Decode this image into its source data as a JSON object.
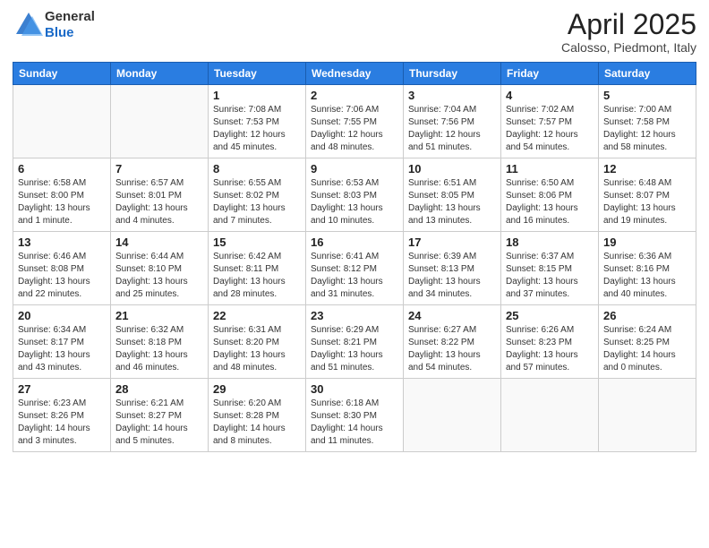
{
  "header": {
    "logo_general": "General",
    "logo_blue": "Blue",
    "title": "April 2025",
    "subtitle": "Calosso, Piedmont, Italy"
  },
  "calendar": {
    "days_of_week": [
      "Sunday",
      "Monday",
      "Tuesday",
      "Wednesday",
      "Thursday",
      "Friday",
      "Saturday"
    ],
    "weeks": [
      [
        {
          "day": "",
          "info": ""
        },
        {
          "day": "",
          "info": ""
        },
        {
          "day": "1",
          "info": "Sunrise: 7:08 AM\nSunset: 7:53 PM\nDaylight: 12 hours and 45 minutes."
        },
        {
          "day": "2",
          "info": "Sunrise: 7:06 AM\nSunset: 7:55 PM\nDaylight: 12 hours and 48 minutes."
        },
        {
          "day": "3",
          "info": "Sunrise: 7:04 AM\nSunset: 7:56 PM\nDaylight: 12 hours and 51 minutes."
        },
        {
          "day": "4",
          "info": "Sunrise: 7:02 AM\nSunset: 7:57 PM\nDaylight: 12 hours and 54 minutes."
        },
        {
          "day": "5",
          "info": "Sunrise: 7:00 AM\nSunset: 7:58 PM\nDaylight: 12 hours and 58 minutes."
        }
      ],
      [
        {
          "day": "6",
          "info": "Sunrise: 6:58 AM\nSunset: 8:00 PM\nDaylight: 13 hours and 1 minute."
        },
        {
          "day": "7",
          "info": "Sunrise: 6:57 AM\nSunset: 8:01 PM\nDaylight: 13 hours and 4 minutes."
        },
        {
          "day": "8",
          "info": "Sunrise: 6:55 AM\nSunset: 8:02 PM\nDaylight: 13 hours and 7 minutes."
        },
        {
          "day": "9",
          "info": "Sunrise: 6:53 AM\nSunset: 8:03 PM\nDaylight: 13 hours and 10 minutes."
        },
        {
          "day": "10",
          "info": "Sunrise: 6:51 AM\nSunset: 8:05 PM\nDaylight: 13 hours and 13 minutes."
        },
        {
          "day": "11",
          "info": "Sunrise: 6:50 AM\nSunset: 8:06 PM\nDaylight: 13 hours and 16 minutes."
        },
        {
          "day": "12",
          "info": "Sunrise: 6:48 AM\nSunset: 8:07 PM\nDaylight: 13 hours and 19 minutes."
        }
      ],
      [
        {
          "day": "13",
          "info": "Sunrise: 6:46 AM\nSunset: 8:08 PM\nDaylight: 13 hours and 22 minutes."
        },
        {
          "day": "14",
          "info": "Sunrise: 6:44 AM\nSunset: 8:10 PM\nDaylight: 13 hours and 25 minutes."
        },
        {
          "day": "15",
          "info": "Sunrise: 6:42 AM\nSunset: 8:11 PM\nDaylight: 13 hours and 28 minutes."
        },
        {
          "day": "16",
          "info": "Sunrise: 6:41 AM\nSunset: 8:12 PM\nDaylight: 13 hours and 31 minutes."
        },
        {
          "day": "17",
          "info": "Sunrise: 6:39 AM\nSunset: 8:13 PM\nDaylight: 13 hours and 34 minutes."
        },
        {
          "day": "18",
          "info": "Sunrise: 6:37 AM\nSunset: 8:15 PM\nDaylight: 13 hours and 37 minutes."
        },
        {
          "day": "19",
          "info": "Sunrise: 6:36 AM\nSunset: 8:16 PM\nDaylight: 13 hours and 40 minutes."
        }
      ],
      [
        {
          "day": "20",
          "info": "Sunrise: 6:34 AM\nSunset: 8:17 PM\nDaylight: 13 hours and 43 minutes."
        },
        {
          "day": "21",
          "info": "Sunrise: 6:32 AM\nSunset: 8:18 PM\nDaylight: 13 hours and 46 minutes."
        },
        {
          "day": "22",
          "info": "Sunrise: 6:31 AM\nSunset: 8:20 PM\nDaylight: 13 hours and 48 minutes."
        },
        {
          "day": "23",
          "info": "Sunrise: 6:29 AM\nSunset: 8:21 PM\nDaylight: 13 hours and 51 minutes."
        },
        {
          "day": "24",
          "info": "Sunrise: 6:27 AM\nSunset: 8:22 PM\nDaylight: 13 hours and 54 minutes."
        },
        {
          "day": "25",
          "info": "Sunrise: 6:26 AM\nSunset: 8:23 PM\nDaylight: 13 hours and 57 minutes."
        },
        {
          "day": "26",
          "info": "Sunrise: 6:24 AM\nSunset: 8:25 PM\nDaylight: 14 hours and 0 minutes."
        }
      ],
      [
        {
          "day": "27",
          "info": "Sunrise: 6:23 AM\nSunset: 8:26 PM\nDaylight: 14 hours and 3 minutes."
        },
        {
          "day": "28",
          "info": "Sunrise: 6:21 AM\nSunset: 8:27 PM\nDaylight: 14 hours and 5 minutes."
        },
        {
          "day": "29",
          "info": "Sunrise: 6:20 AM\nSunset: 8:28 PM\nDaylight: 14 hours and 8 minutes."
        },
        {
          "day": "30",
          "info": "Sunrise: 6:18 AM\nSunset: 8:30 PM\nDaylight: 14 hours and 11 minutes."
        },
        {
          "day": "",
          "info": ""
        },
        {
          "day": "",
          "info": ""
        },
        {
          "day": "",
          "info": ""
        }
      ]
    ]
  }
}
